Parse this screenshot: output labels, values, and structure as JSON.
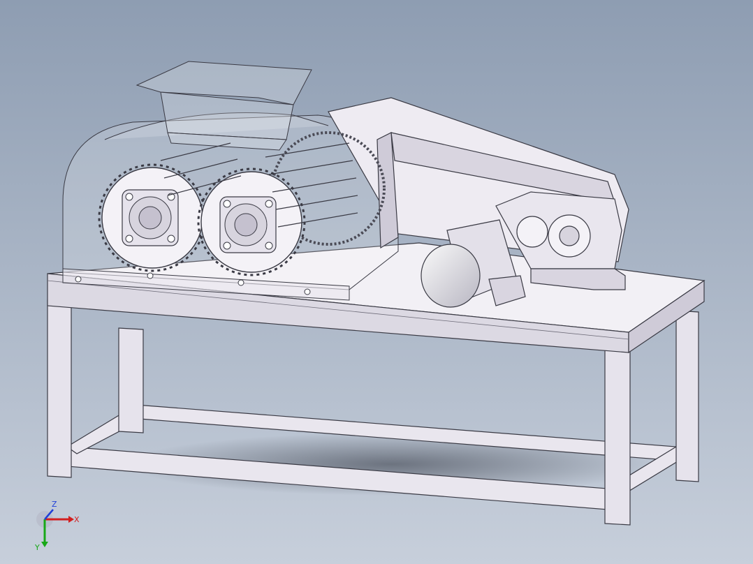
{
  "viewport": {
    "background_top": "#8e9db2",
    "background_bottom": "#c7cfdb",
    "model_fill": "#e9e6ee",
    "model_shade": "#cfcbd8",
    "model_edge": "#3a3a44",
    "glass_fill": "#ffffff"
  },
  "triad": {
    "x_label": "X",
    "y_label": "Y",
    "z_label": "Z",
    "x_color": "#d21f1f",
    "y_color": "#18a818",
    "z_color": "#1f3fd8"
  }
}
